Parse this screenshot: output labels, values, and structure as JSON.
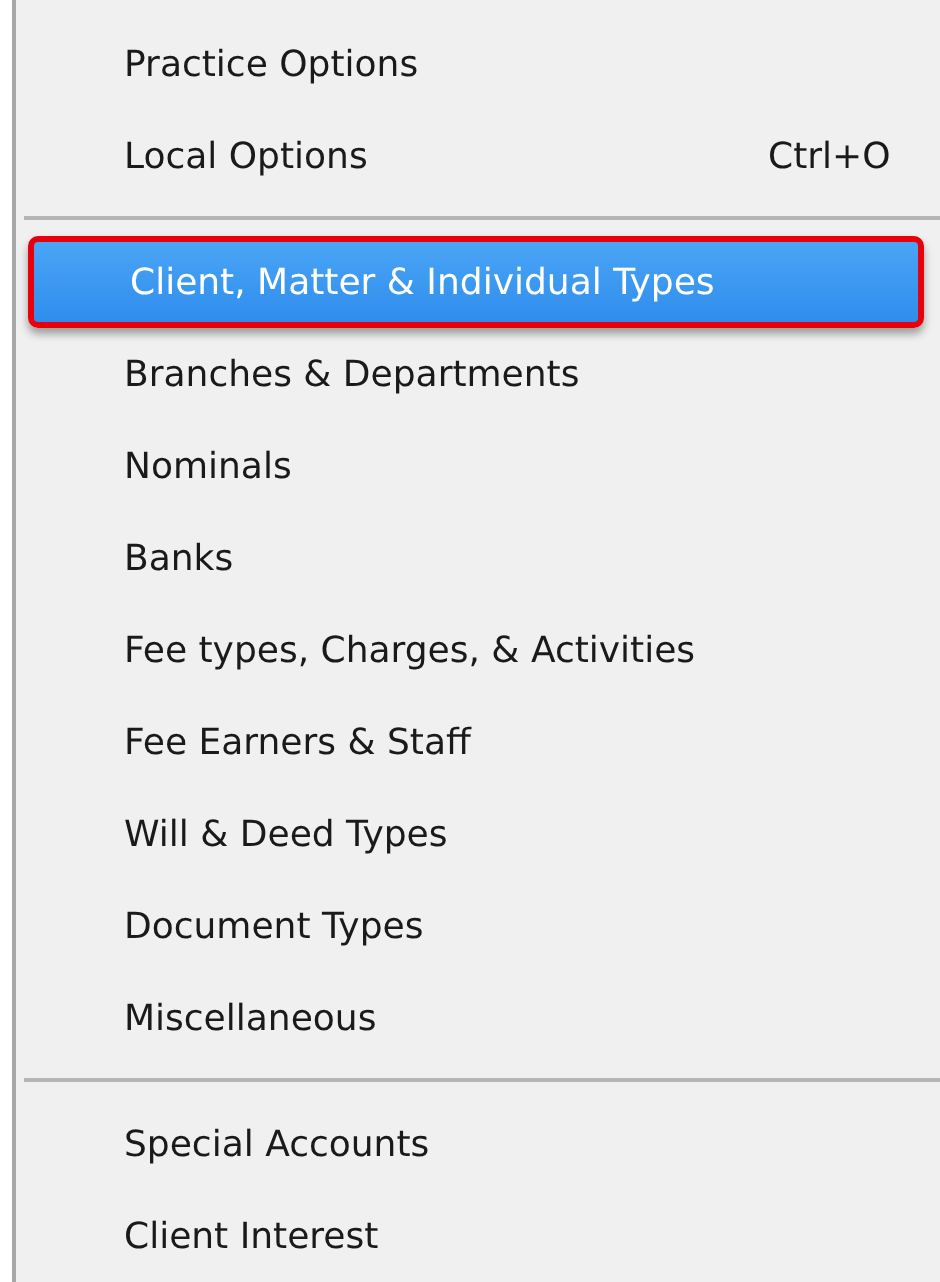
{
  "menu": {
    "groups": [
      {
        "items": [
          {
            "label": "Practice Options",
            "selected": false
          },
          {
            "label": "Local Options",
            "shortcut": "Ctrl+O",
            "selected": false
          }
        ]
      },
      {
        "items": [
          {
            "label": "Client, Matter & Individual Types",
            "selected": true
          },
          {
            "label": "Branches & Departments",
            "selected": false
          },
          {
            "label": "Nominals",
            "selected": false
          },
          {
            "label": "Banks",
            "selected": false
          },
          {
            "label": "Fee types, Charges, & Activities",
            "selected": false
          },
          {
            "label": "Fee Earners & Staff",
            "selected": false
          },
          {
            "label": "Will & Deed Types",
            "selected": false
          },
          {
            "label": "Document Types",
            "selected": false
          },
          {
            "label": "Miscellaneous",
            "selected": false
          }
        ]
      },
      {
        "items": [
          {
            "label": "Special Accounts",
            "selected": false
          },
          {
            "label": "Client Interest",
            "selected": false
          }
        ]
      }
    ]
  }
}
